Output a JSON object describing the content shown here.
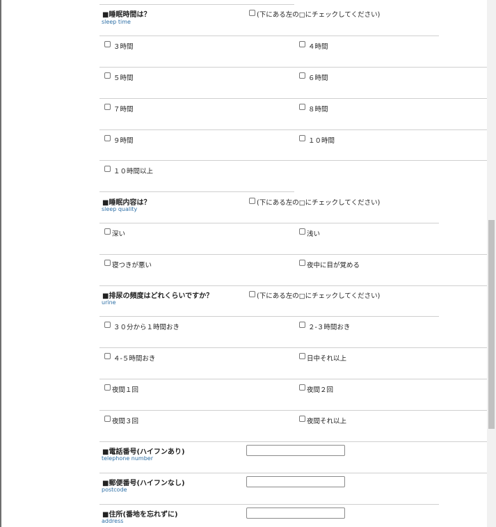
{
  "form": {
    "sleep_time": {
      "title": "■睡眠時間は？",
      "subtitle": "sleep time",
      "note": "(下にある左の□にチェックしてください)",
      "options": [
        "３時間",
        "４時間",
        "５時間",
        "６時間",
        "７時間",
        "８時間",
        "９時間",
        "１０時間",
        "１０時間以上"
      ]
    },
    "sleep_quality": {
      "title": "■睡眠内容は？",
      "subtitle": "sleep quality",
      "note": "(下にある左の□にチェックしてください)",
      "options": [
        "深い",
        "浅い",
        "寝つきが悪い",
        "夜中に目が覚める"
      ]
    },
    "urine": {
      "title": "■排尿の頻度はどれくらいですか？",
      "subtitle": "urine",
      "note": "(下にある左の□にチェックしてください)",
      "options": [
        "３０分から１時間おき",
        "２-３時間おき",
        "４-５時間おき",
        "日中それ以上",
        "夜間１回",
        "夜間２回",
        "夜間３回",
        "夜間それ以上"
      ]
    },
    "telephone": {
      "title": "■電話番号(ハイフンあり)",
      "subtitle": "telephone number",
      "value": ""
    },
    "postcode": {
      "title": "■郵便番号(ハイフンなし)",
      "subtitle": "postcode",
      "value": ""
    },
    "address": {
      "title": "■住所(番地を忘れずに)",
      "subtitle": "address",
      "value": ""
    }
  }
}
